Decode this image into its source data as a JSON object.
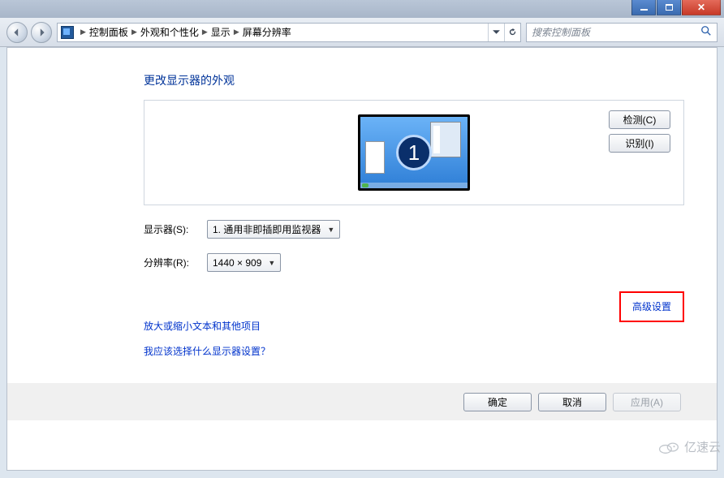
{
  "breadcrumb": {
    "items": [
      "控制面板",
      "外观和个性化",
      "显示",
      "屏幕分辨率"
    ]
  },
  "search": {
    "placeholder": "搜索控制面板"
  },
  "page": {
    "title": "更改显示器的外观"
  },
  "preview": {
    "monitor_number": "1",
    "detect_label": "检测(C)",
    "identify_label": "识别(I)"
  },
  "display_field": {
    "label": "显示器(S):",
    "value": "1. 通用非即插即用监视器"
  },
  "resolution_field": {
    "label": "分辨率(R):",
    "value": "1440 × 909"
  },
  "advanced_link": "高级设置",
  "links": {
    "text_scale": "放大或缩小文本和其他项目",
    "which_settings": "我应该选择什么显示器设置？"
  },
  "footer": {
    "ok": "确定",
    "cancel": "取消",
    "apply": "应用(A)"
  },
  "watermark": "亿速云"
}
